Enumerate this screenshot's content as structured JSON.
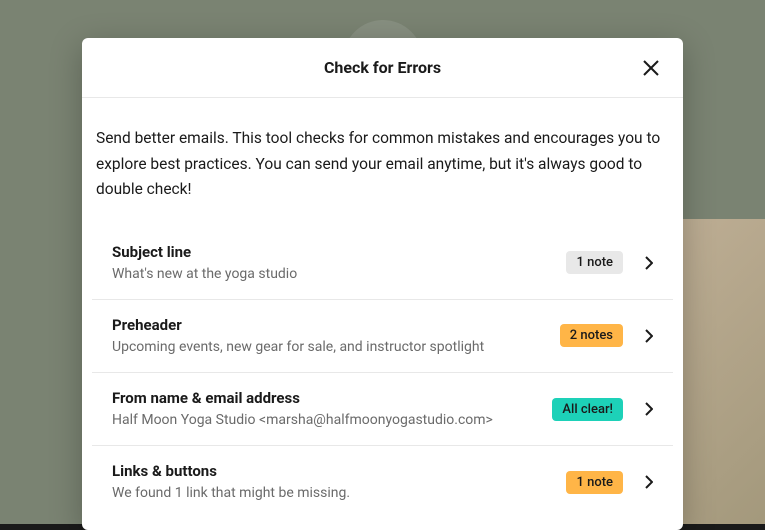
{
  "modal": {
    "title": "Check for Errors",
    "description": "Send better emails. This tool checks for common mistakes and encourages you to explore best practices. You can send your email anytime, but it's always good to double check!"
  },
  "checks": [
    {
      "title": "Subject line",
      "subtitle": "What's new at the yoga studio",
      "badge_text": "1 note",
      "badge_style": "gray"
    },
    {
      "title": "Preheader",
      "subtitle": "Upcoming events, new gear for sale, and instructor spotlight",
      "badge_text": "2 notes",
      "badge_style": "orange"
    },
    {
      "title": "From name & email address",
      "subtitle": "Half Moon Yoga Studio <marsha@halfmoonyogastudio.com>",
      "badge_text": "All clear!",
      "badge_style": "teal"
    },
    {
      "title": "Links & buttons",
      "subtitle": "We found 1 link that might be missing.",
      "badge_text": "1 note",
      "badge_style": "orange"
    }
  ]
}
